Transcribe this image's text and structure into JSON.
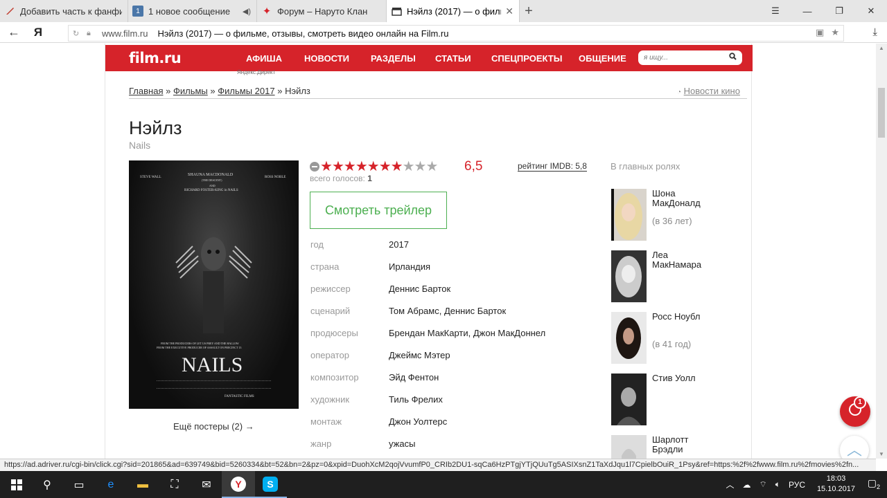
{
  "browser": {
    "tabs": [
      {
        "title": "Добавить часть к фанфику",
        "icon": "quill-icon",
        "active": false
      },
      {
        "title": "1 новое сообщение",
        "icon": "vk-icon",
        "active": false
      },
      {
        "title": "Форум – Наруто Клан",
        "icon": "shuriken-icon",
        "active": false
      },
      {
        "title": "Нэйлз (2017) — о фильм",
        "icon": "film-clapper-icon",
        "active": true
      }
    ],
    "address": {
      "domain": "www.film.ru",
      "page_title": "Нэйлз (2017) — о фильме, отзывы, смотреть видео онлайн на Film.ru"
    },
    "yandex_logo": "Я"
  },
  "site": {
    "logo": "film.ru",
    "nav": [
      "АФИША",
      "НОВОСТИ",
      "РАЗДЕЛЫ",
      "СТАТЬИ",
      "СПЕЦПРОЕКТЫ",
      "ОБЩЕНИЕ"
    ],
    "search_placeholder": "я ищу...",
    "ad_label": "Яндекс.Директ",
    "breadcrumbs": [
      "Главная",
      "Фильмы",
      "Фильмы 2017",
      "Нэйлз"
    ],
    "breadcrumb_separator": "»",
    "news_link": "Новости кино"
  },
  "movie": {
    "title": "Нэйлз",
    "original_title": "Nails",
    "poster": {
      "top_names": [
        "STEVE WALL",
        "SHAUNA MACDONALD",
        "ROSS NOBLE"
      ],
      "subtitle": "(THE DESCENT)",
      "and_line": "AND",
      "tagline2": "RICHARD FOSTER-KING in NAILS",
      "producers_line1": "FROM THE PRODUCERS OF LET US PREY AND THE HALLOW",
      "producers_line2": "FROM THE EXECUTIVE PRODUCER OF ASSAULT ON PRECINCT 13",
      "title": "NAILS",
      "studio": "FANTASTIC FILMS"
    },
    "more_posters": "Ещё постеры (2) →",
    "rating": {
      "value": "6,5",
      "stars_filled": 7,
      "stars_total": 10
    },
    "imdb_rating": "рейтинг IMDB: 5,8",
    "votes_label": "всего голосов:",
    "votes_count": "1",
    "trailer_button": "Смотреть трейлер",
    "info": [
      {
        "label": "год",
        "value": "2017"
      },
      {
        "label": "страна",
        "value": "Ирландия"
      },
      {
        "label": "режиссер",
        "value": "Деннис Барток"
      },
      {
        "label": "сценарий",
        "value": "Том Абрамс, Деннис Барток"
      },
      {
        "label": "продюсеры",
        "value": "Брендан МакКарти, Джон МакДоннел"
      },
      {
        "label": "оператор",
        "value": "Джеймс Мэтер"
      },
      {
        "label": "композитор",
        "value": "Эйд Фентон"
      },
      {
        "label": "художник",
        "value": "Тиль Фрелих"
      },
      {
        "label": "монтаж",
        "value": "Джон Уолтерс"
      },
      {
        "label": "жанр",
        "value": "ужасы"
      }
    ],
    "cast_heading": "В главных ролях",
    "cast": [
      {
        "name": "Шона МакДоналд",
        "age": "(в 36 лет)"
      },
      {
        "name": "Леа МакНамара",
        "age": ""
      },
      {
        "name": "Росс Ноубл",
        "age": "(в 41 год)"
      },
      {
        "name": "Стив Уолл",
        "age": ""
      },
      {
        "name": "Шарлотт Брэдли",
        "age": ""
      }
    ]
  },
  "notifications_badge": "1",
  "status_url": "https://ad.adriver.ru/cgi-bin/click.cgi?sid=201865&ad=639749&bid=5260334&bt=52&bn=2&pz=0&xpid=DuohXcM2qojVvumfP0_CRIb2DU1-sqCa6HzPTgjYTjQUuTg5ASIXsnZ1TaXdJqu1l7CpielbOuiR_1Psy&ref=https:%2f%2fwww.film.ru%2fmovies%2fn...",
  "taskbar": {
    "language": "РУС",
    "time": "18:03",
    "date": "15.10.2017",
    "notification_count": "2"
  },
  "colors": {
    "brand_red": "#d6232a",
    "trailer_green": "#4caf50"
  }
}
